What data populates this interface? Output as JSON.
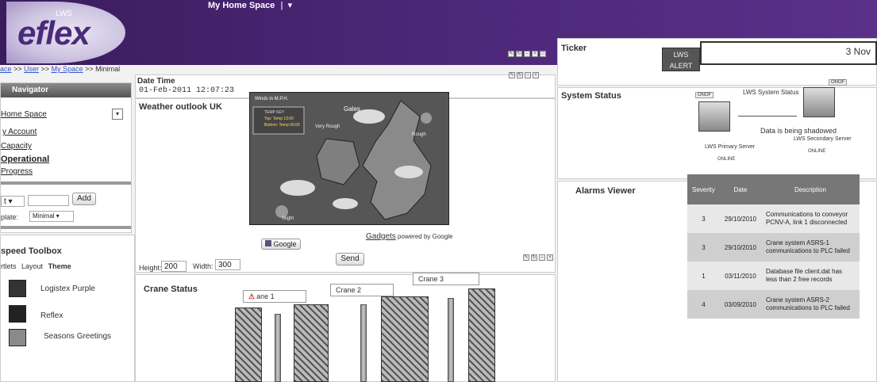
{
  "header": {
    "logo_text": "eflex",
    "logo_brand": "LWS",
    "space_menu": "My Home Space",
    "space_sep": "|"
  },
  "breadcrumb": {
    "prefix": "ace",
    "sep1": " >> ",
    "user": "User",
    "sep2": " >> ",
    "myspace": "My Space",
    "sep3": " >> ",
    "current": "Minimal"
  },
  "navigator": {
    "title": "Navigator",
    "home_space": "Home Space",
    "links": [
      "y Account",
      "Capacity",
      "Operational",
      "Progress"
    ],
    "add_label": "Add",
    "template_label": "plate:",
    "template_value": "Minimal"
  },
  "toolbox": {
    "title": "speed Toolbox",
    "tabs": [
      "rtlets",
      "Layout",
      "Theme"
    ],
    "themes": [
      {
        "name": "Logistex Purple",
        "color": "#3a3a3a"
      },
      {
        "name": "Reflex",
        "color": "#2a2a2a"
      },
      {
        "name": "Seasons Greetings",
        "color": "#8a8a8a"
      }
    ]
  },
  "datetime": {
    "title": "Date Time",
    "value": "01-Feb-2011 12:07:23"
  },
  "weather": {
    "title": "Weather outlook UK",
    "map_title": "Winds in M.P.H.",
    "gales": "Gales",
    "very_rough": "Very Rough",
    "rough": "Rough",
    "slight": "Slight",
    "legend1": "TEMP KEY",
    "legend2": "Top: Temp 13:00",
    "legend3": "Bottom: Temp 00:00",
    "google_btn": "Google",
    "gadgets": "Gadgets",
    "powered": "powered by Google",
    "send": "Send",
    "height_label": "Height:",
    "height_value": "200",
    "width_label": "Width:",
    "width_value": "300"
  },
  "cranes": {
    "title": "Crane Status",
    "labels": [
      "ane 1",
      "Crane 2",
      "Crane 3"
    ]
  },
  "ticker": {
    "title": "Ticker",
    "alert_line1": "LWS",
    "alert_line2": "ALERT",
    "date": "3 Nov"
  },
  "system": {
    "title": "System Status",
    "chip1": "ONOF",
    "chip2": "ONOF",
    "heading": "LWS System Status",
    "message": "Data is being shadowed",
    "primary": "LWS Primary Server",
    "primary_state": "ONLINE",
    "secondary": "LWS Secondary Server",
    "secondary_state": "ONLINE"
  },
  "alarms": {
    "title": "Alarms Viewer",
    "headers": [
      "Severity",
      "Date",
      "Description"
    ],
    "rows": [
      {
        "severity": "3",
        "date": "29/10/2010",
        "description": "Communications to conveyor PCNV-A, link 1 disconnected"
      },
      {
        "severity": "3",
        "date": "29/10/2010",
        "description": "Crane system ASRS-1 communications to PLC failed"
      },
      {
        "severity": "1",
        "date": "03/11/2010",
        "description": "Database file client.dat has less than 2 free records"
      },
      {
        "severity": "4",
        "date": "03/09/2010",
        "description": "Crane system ASRS-2 communications to PLC failed"
      }
    ]
  }
}
